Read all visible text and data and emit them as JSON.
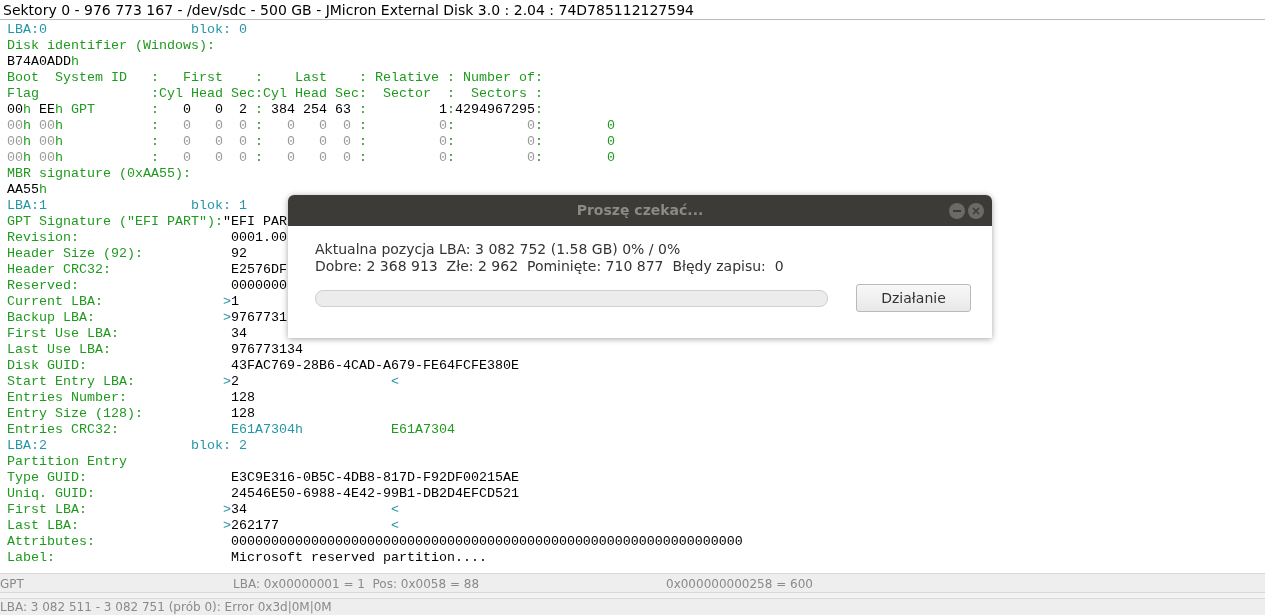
{
  "window": {
    "title": "Sektory 0 - 976 773 167 - /dev/sdc - 500 GB - JMicron External Disk 3.0 : 2.04 : 74D785112127594"
  },
  "lines": [
    [
      {
        "kind": "mark",
        "text": "LBA:0                  blok: 0"
      }
    ],
    [
      {
        "kind": "label",
        "text": "Disk identifier (Windows):"
      }
    ],
    [
      {
        "kind": "value",
        "text": "B74A0ADD"
      },
      {
        "kind": "label",
        "text": "h"
      }
    ],
    [
      {
        "kind": "label",
        "text": "Boot  System ID   :   First    :    Last    : Relative : Number of:"
      }
    ],
    [
      {
        "kind": "label",
        "text": "Flag              :Cyl Head Sec:Cyl Head Sec:  Sector  :  Sectors :"
      }
    ],
    [
      {
        "kind": "value",
        "text": "00"
      },
      {
        "kind": "label",
        "text": "h "
      },
      {
        "kind": "value",
        "text": "EE"
      },
      {
        "kind": "label",
        "text": "h GPT       :  "
      },
      {
        "kind": "value",
        "text": " 0   0  2 "
      },
      {
        "kind": "label",
        "text": ": "
      },
      {
        "kind": "value",
        "text": "384 254 63 "
      },
      {
        "kind": "label",
        "text": ":"
      },
      {
        "kind": "value",
        "text": "         1"
      },
      {
        "kind": "label",
        "text": ":"
      },
      {
        "kind": "value",
        "text": "4294967295"
      },
      {
        "kind": "label",
        "text": ":"
      }
    ],
    [
      {
        "kind": "dim",
        "text": "00"
      },
      {
        "kind": "label",
        "text": "h "
      },
      {
        "kind": "dim",
        "text": "00"
      },
      {
        "kind": "label",
        "text": "h           :"
      },
      {
        "kind": "dim",
        "text": "   0   0  0 "
      },
      {
        "kind": "label",
        "text": ":"
      },
      {
        "kind": "dim",
        "text": "   0   0  0 "
      },
      {
        "kind": "label",
        "text": ":"
      },
      {
        "kind": "dim",
        "text": "         0"
      },
      {
        "kind": "label",
        "text": ":"
      },
      {
        "kind": "dim",
        "text": "         0"
      },
      {
        "kind": "label",
        "text": ":        0"
      }
    ],
    [
      {
        "kind": "dim",
        "text": "00"
      },
      {
        "kind": "label",
        "text": "h "
      },
      {
        "kind": "dim",
        "text": "00"
      },
      {
        "kind": "label",
        "text": "h           :"
      },
      {
        "kind": "dim",
        "text": "   0   0  0 "
      },
      {
        "kind": "label",
        "text": ":"
      },
      {
        "kind": "dim",
        "text": "   0   0  0 "
      },
      {
        "kind": "label",
        "text": ":"
      },
      {
        "kind": "dim",
        "text": "         0"
      },
      {
        "kind": "label",
        "text": ":"
      },
      {
        "kind": "dim",
        "text": "         0"
      },
      {
        "kind": "label",
        "text": ":        0"
      }
    ],
    [
      {
        "kind": "dim",
        "text": "00"
      },
      {
        "kind": "label",
        "text": "h "
      },
      {
        "kind": "dim",
        "text": "00"
      },
      {
        "kind": "label",
        "text": "h           :"
      },
      {
        "kind": "dim",
        "text": "   0   0  0 "
      },
      {
        "kind": "label",
        "text": ":"
      },
      {
        "kind": "dim",
        "text": "   0   0  0 "
      },
      {
        "kind": "label",
        "text": ":"
      },
      {
        "kind": "dim",
        "text": "         0"
      },
      {
        "kind": "label",
        "text": ":"
      },
      {
        "kind": "dim",
        "text": "         0"
      },
      {
        "kind": "label",
        "text": ":        0"
      }
    ],
    [
      {
        "kind": "label",
        "text": "MBR signature (0xAA55):"
      }
    ],
    [
      {
        "kind": "value",
        "text": "AA55"
      },
      {
        "kind": "label",
        "text": "h"
      }
    ],
    [
      {
        "kind": "mark",
        "text": "LBA:1                  blok: 1"
      }
    ],
    [
      {
        "kind": "label",
        "text": "GPT Signature (\"EFI PART\"):"
      },
      {
        "kind": "value",
        "text": "\"EFI PAR"
      }
    ],
    [
      {
        "kind": "label",
        "text": "Revision:                   "
      },
      {
        "kind": "value",
        "text": "0001.00"
      }
    ],
    [
      {
        "kind": "label",
        "text": "Header Size (92):           "
      },
      {
        "kind": "value",
        "text": "92"
      }
    ],
    [
      {
        "kind": "label",
        "text": "Header CRC32:               "
      },
      {
        "kind": "value",
        "text": "E2576DF"
      }
    ],
    [
      {
        "kind": "label",
        "text": "Reserved:                   "
      },
      {
        "kind": "value",
        "text": "0000000"
      }
    ],
    [
      {
        "kind": "label",
        "text": "Current LBA:               "
      },
      {
        "kind": "mark",
        "text": ">"
      },
      {
        "kind": "value",
        "text": "1"
      }
    ],
    [
      {
        "kind": "label",
        "text": "Backup LBA:                "
      },
      {
        "kind": "mark",
        "text": ">"
      },
      {
        "kind": "value",
        "text": "9767731"
      }
    ],
    [
      {
        "kind": "label",
        "text": "First Use LBA:              "
      },
      {
        "kind": "value",
        "text": "34"
      }
    ],
    [
      {
        "kind": "label",
        "text": "Last Use LBA:               "
      },
      {
        "kind": "value",
        "text": "976773134"
      }
    ],
    [
      {
        "kind": "label",
        "text": "Disk GUID:                  "
      },
      {
        "kind": "value",
        "text": "43FAC769-28B6-4CAD-A679-FE64FCFE380E"
      }
    ],
    [
      {
        "kind": "label",
        "text": "Start Entry LBA:           "
      },
      {
        "kind": "mark",
        "text": ">"
      },
      {
        "kind": "value",
        "text": "2"
      },
      {
        "kind": "mark",
        "text": "                   <"
      }
    ],
    [
      {
        "kind": "label",
        "text": "Entries Number:             "
      },
      {
        "kind": "value",
        "text": "128"
      }
    ],
    [
      {
        "kind": "label",
        "text": "Entry Size (128):           "
      },
      {
        "kind": "value",
        "text": "128"
      }
    ],
    [
      {
        "kind": "label",
        "text": "Entries CRC32:              "
      },
      {
        "kind": "mark",
        "text": "E61A7304h"
      },
      {
        "kind": "label",
        "text": "           E61A7304"
      }
    ],
    [
      {
        "kind": "mark",
        "text": "LBA:2                  blok: 2"
      }
    ],
    [
      {
        "kind": "label",
        "text": "Partition Entry"
      }
    ],
    [
      {
        "kind": "label",
        "text": "Type GUID:                  "
      },
      {
        "kind": "value",
        "text": "E3C9E316-0B5C-4DB8-817D-F92DF00215AE"
      }
    ],
    [
      {
        "kind": "label",
        "text": "Uniq. GUID:                 "
      },
      {
        "kind": "value",
        "text": "24546E50-6988-4E42-99B1-DB2D4EFCD521"
      }
    ],
    [
      {
        "kind": "label",
        "text": "First LBA:                 "
      },
      {
        "kind": "mark",
        "text": ">"
      },
      {
        "kind": "value",
        "text": "34"
      },
      {
        "kind": "mark",
        "text": "                  <"
      }
    ],
    [
      {
        "kind": "label",
        "text": "Last LBA:                  "
      },
      {
        "kind": "mark",
        "text": ">"
      },
      {
        "kind": "value",
        "text": "262177"
      },
      {
        "kind": "mark",
        "text": "              <"
      }
    ],
    [
      {
        "kind": "label",
        "text": "Attributes:                 "
      },
      {
        "kind": "value",
        "text": "0000000000000000000000000000000000000000000000000000000000000000"
      }
    ],
    [
      {
        "kind": "label",
        "text": "Label:                      "
      },
      {
        "kind": "value",
        "text": "Microsoft reserved partition...."
      }
    ]
  ],
  "dialog": {
    "title": "Proszę czekać...",
    "lines": [
      "Aktualna pozycja LBA: 3 082 752 (1.58 GB) 0% / 0%",
      "Dobre: 2 368 913  Złe: 2 962  Pominięte: 710 877  Błędy zapisu:  0"
    ],
    "progress": {
      "level": 0
    },
    "button": "Działanie"
  },
  "status_bar": [
    "GPT",
    "LBA: 0x00000001 = 1  Pos: 0x0058 = 88",
    "0x000000000258 = 600"
  ],
  "error_bar": "LBA: 3 082 511 - 3 082 751 (prób 0): Error 0x3d|0M|0M"
}
